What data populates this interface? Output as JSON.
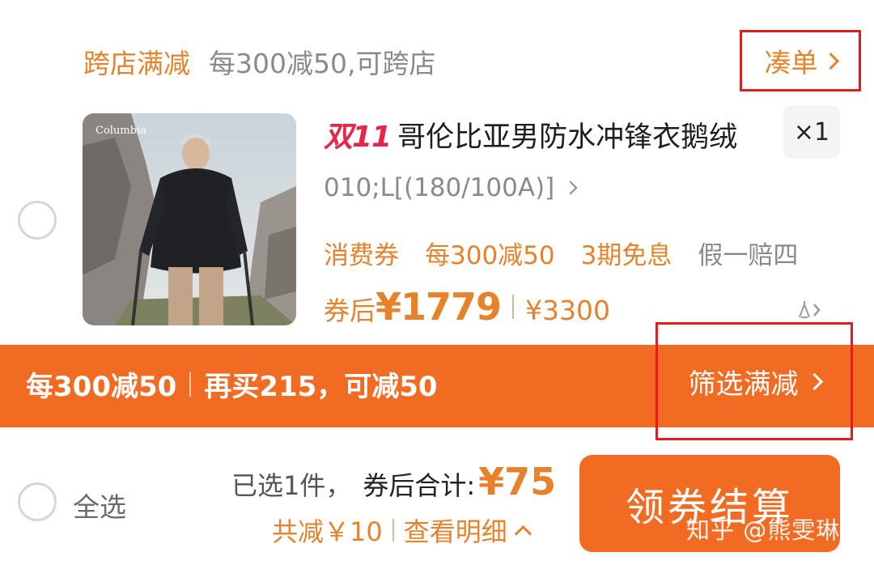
{
  "promo": {
    "tag": "跨店满减",
    "description": "每300减50,可跨店",
    "collect_label": "凑单"
  },
  "product": {
    "image_brand": "Columbia",
    "badge": "双11",
    "title": "哥伦比亚男防水冲锋衣鹅绒",
    "quantity": "×1",
    "sku": "010;L[(180/100A)]",
    "benefits": [
      "消费券",
      "每300减50",
      "3期免息",
      "假一赔四"
    ],
    "price_label": "券后",
    "price_after": "¥1779",
    "price_original": "¥3300"
  },
  "discount_bar": {
    "rule": "每300减50",
    "hint": "再买215，可减50",
    "filter_label": "筛选满减"
  },
  "footer": {
    "select_all": "全选",
    "selected_text": "已选1件，",
    "total_label": "券后合计:",
    "total_price": "¥75",
    "savings": "共减￥10",
    "details_label": "查看明细",
    "checkout_label": "领券结算",
    "watermark": "知乎 @熊雯琳"
  },
  "colors": {
    "accent": "#f26b23",
    "price_orange": "#e8822a",
    "badge_red": "#e82549",
    "annotation_red": "#e11d1d"
  },
  "icons": [
    "chevron-right-icon",
    "compare-icon",
    "chevron-up-icon"
  ]
}
